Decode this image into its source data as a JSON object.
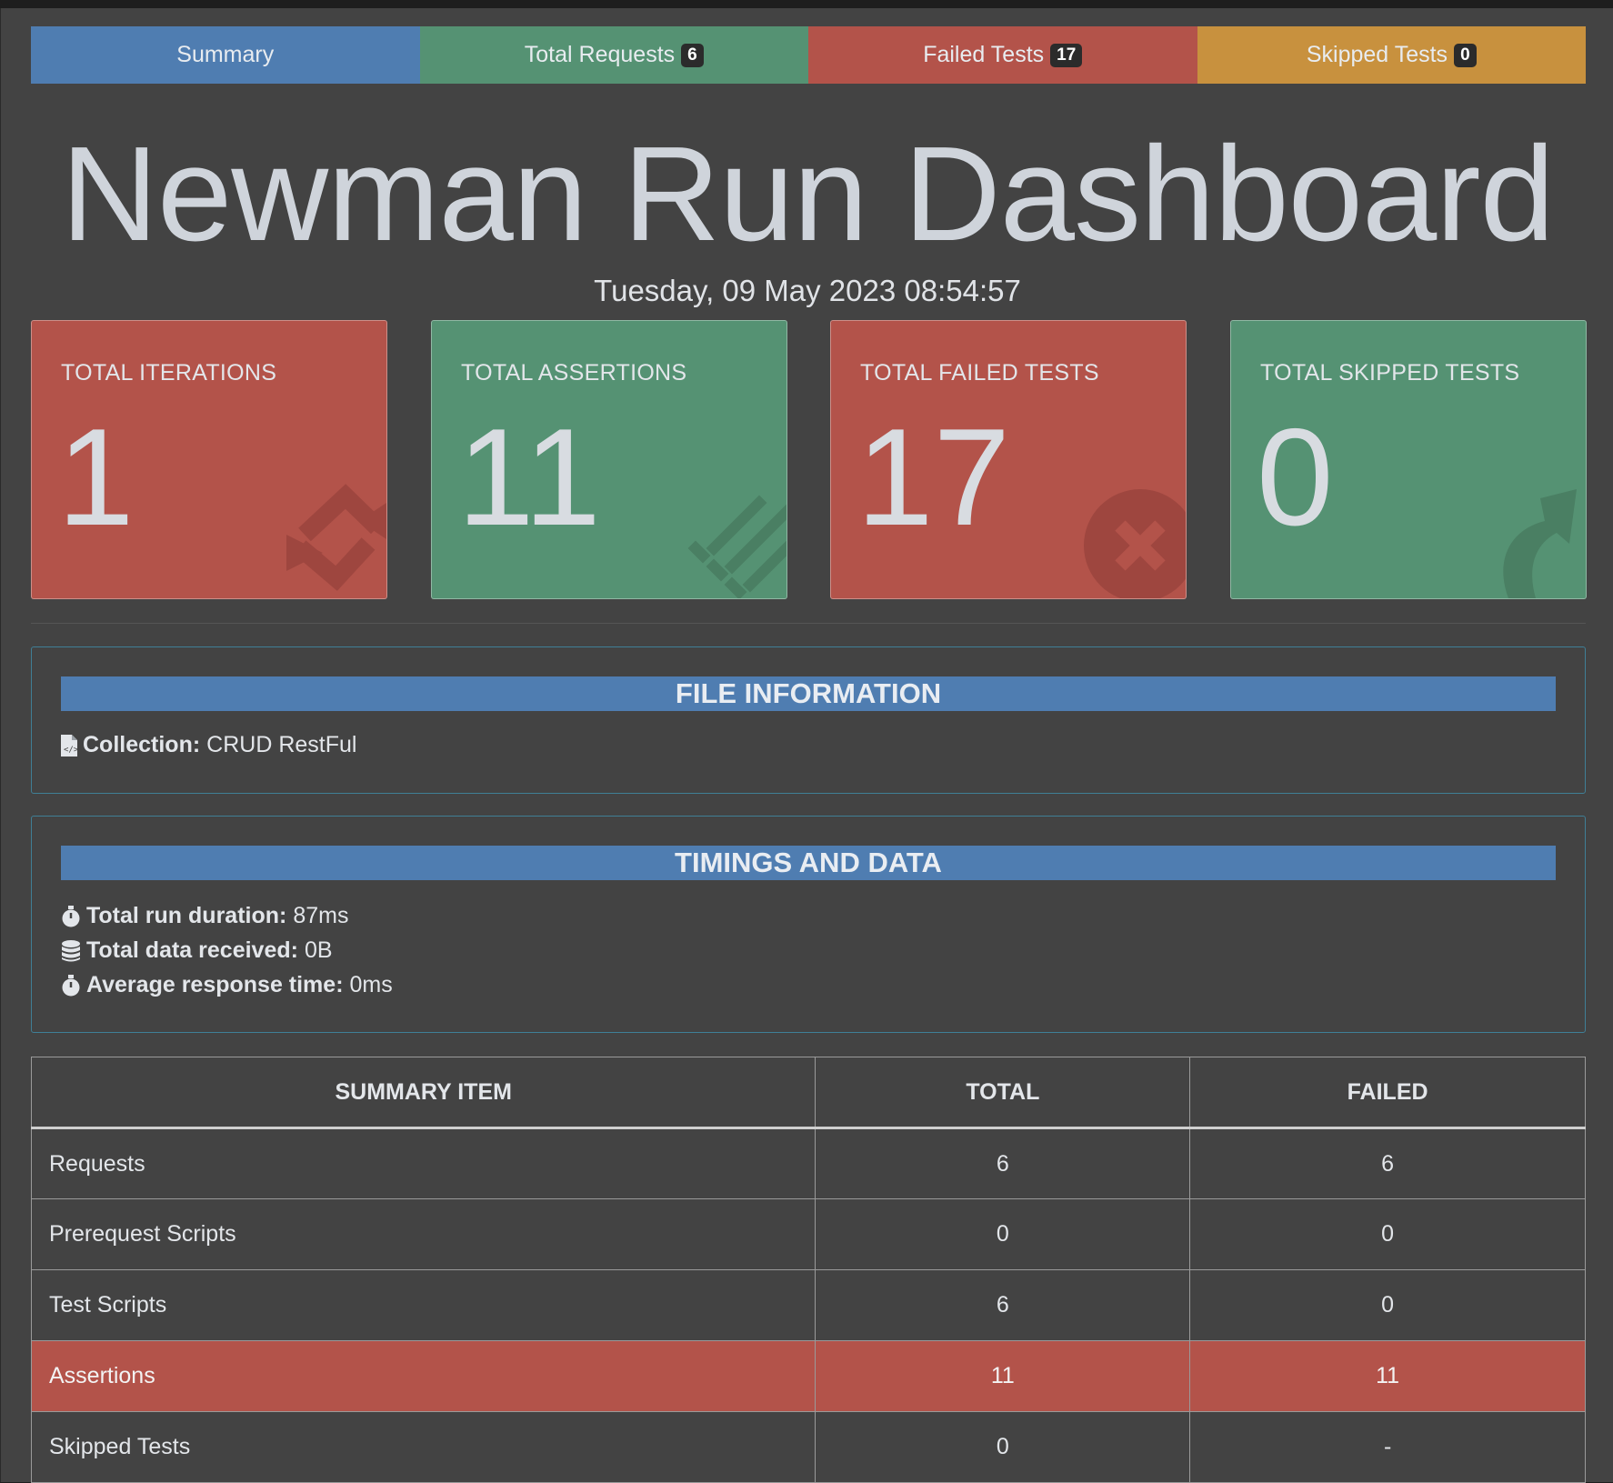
{
  "tabs": [
    {
      "label": "Summary",
      "badge": null,
      "color": "#4f7db1"
    },
    {
      "label": "Total Requests",
      "badge": "6",
      "color": "#559273"
    },
    {
      "label": "Failed Tests",
      "badge": "17",
      "color": "#b3534a"
    },
    {
      "label": "Skipped Tests",
      "badge": "0",
      "color": "#c8913e"
    }
  ],
  "title": "Newman Run Dashboard",
  "datetime": "Tuesday, 09 May 2023 08:54:57",
  "cards": [
    {
      "label": "TOTAL ITERATIONS",
      "value": "1",
      "icon": "sync-icon"
    },
    {
      "label": "TOTAL ASSERTIONS",
      "value": "11",
      "icon": "list-check-icon"
    },
    {
      "label": "TOTAL FAILED TESTS",
      "value": "17",
      "icon": "times-circle-icon"
    },
    {
      "label": "TOTAL SKIPPED TESTS",
      "value": "0",
      "icon": "share-arrow-icon"
    }
  ],
  "file_info": {
    "heading": "FILE INFORMATION",
    "collection_label": "Collection:",
    "collection_value": "CRUD RestFul"
  },
  "timings": {
    "heading": "TIMINGS AND DATA",
    "run_duration_label": "Total run duration:",
    "run_duration_value": "87ms",
    "data_received_label": "Total data received:",
    "data_received_value": "0B",
    "avg_response_label": "Average response time:",
    "avg_response_value": "0ms"
  },
  "summary_table": {
    "headers": [
      "SUMMARY ITEM",
      "TOTAL",
      "FAILED"
    ],
    "rows": [
      {
        "item": "Requests",
        "total": "6",
        "failed": "6"
      },
      {
        "item": "Prerequest Scripts",
        "total": "0",
        "failed": "0"
      },
      {
        "item": "Test Scripts",
        "total": "6",
        "failed": "0"
      },
      {
        "item": "Assertions",
        "total": "11",
        "failed": "11"
      },
      {
        "item": "Skipped Tests",
        "total": "0",
        "failed": "-"
      }
    ]
  }
}
